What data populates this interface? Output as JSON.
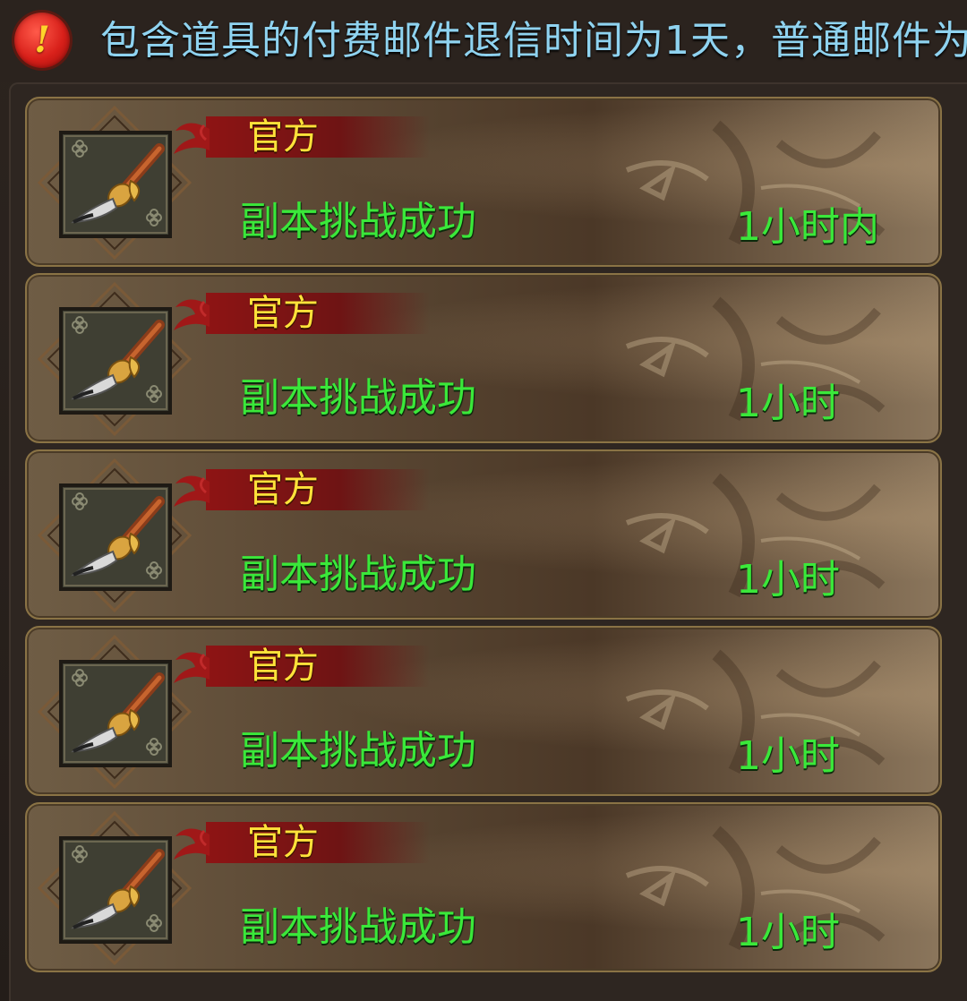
{
  "notice": {
    "icon": "exclamation-icon",
    "text": "包含道具的付费邮件退信时间为1天，普通邮件为"
  },
  "colors": {
    "notice_text": "#8fd3f0",
    "sender": "#ffe23a",
    "subject": "#3ae83a",
    "time": "#3ae83a"
  },
  "mails": [
    {
      "sender": "官方",
      "subject": "副本挑战成功",
      "time": "1小时内",
      "item_icon": "brush-icon"
    },
    {
      "sender": "官方",
      "subject": "副本挑战成功",
      "time": "1小时",
      "item_icon": "brush-icon"
    },
    {
      "sender": "官方",
      "subject": "副本挑战成功",
      "time": "1小时",
      "item_icon": "brush-icon"
    },
    {
      "sender": "官方",
      "subject": "副本挑战成功",
      "time": "1小时",
      "item_icon": "brush-icon"
    },
    {
      "sender": "官方",
      "subject": "副本挑战成功",
      "time": "1小时",
      "item_icon": "brush-icon"
    }
  ]
}
